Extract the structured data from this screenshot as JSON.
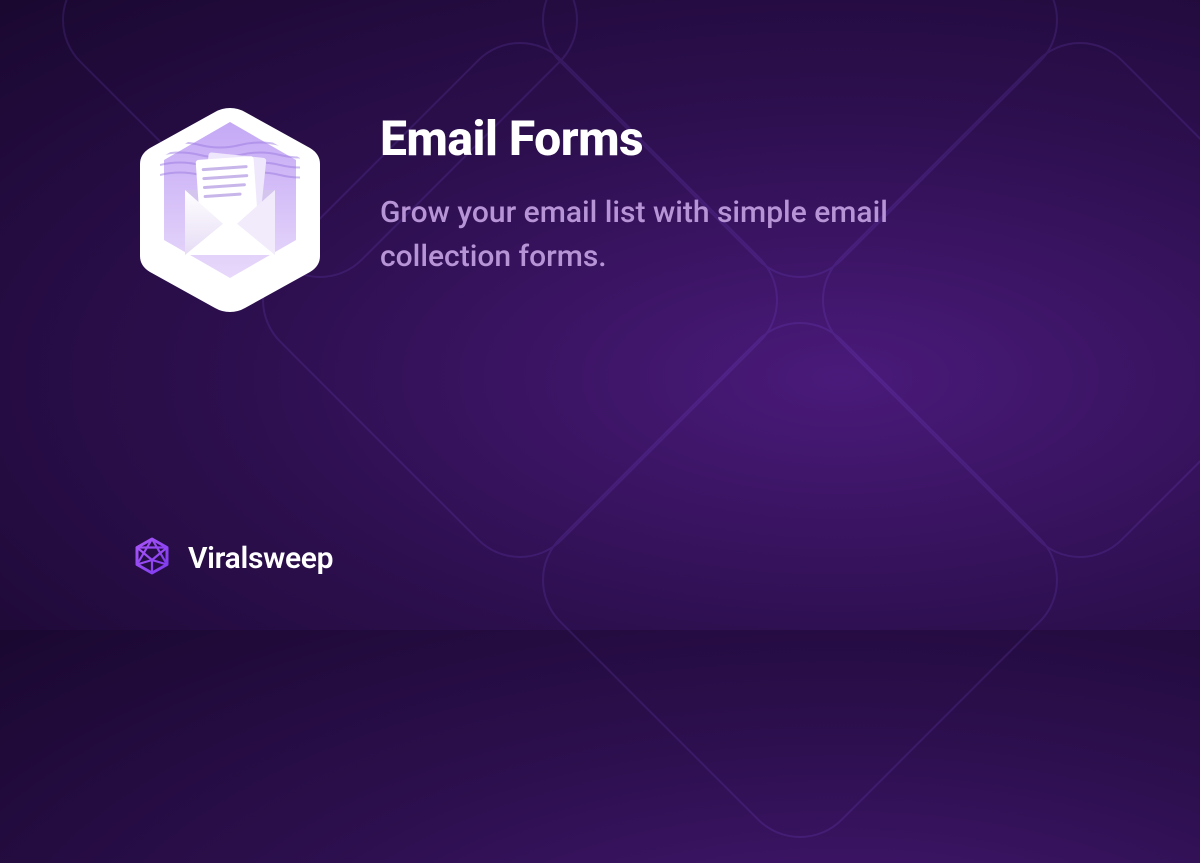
{
  "hero": {
    "title": "Email Forms",
    "subtitle": "Grow your email list with simple email collection forms."
  },
  "brand": {
    "name": "Viralsweep"
  }
}
